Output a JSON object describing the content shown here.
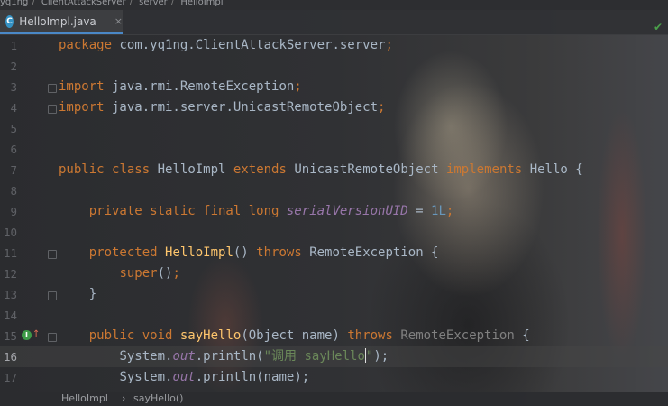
{
  "breadcrumb_top": [
    "yq1ng",
    "ClientAttackServer",
    "server",
    "HelloImpl"
  ],
  "tab": {
    "icon_letter": "C",
    "label": "HelloImpl.java",
    "close": "×"
  },
  "status_breadcrumb": [
    "HelloImpl",
    "sayHello()"
  ],
  "line_numbers": [
    "1",
    "2",
    "3",
    "4",
    "5",
    "6",
    "7",
    "8",
    "9",
    "10",
    "11",
    "12",
    "13",
    "14",
    "15",
    "16",
    "17"
  ],
  "code": {
    "l1_kw": "package",
    "l1_pkg": " com.yq1ng.ClientAttackServer.server",
    "l3_kw": "import",
    "l3_path": " java.rmi.RemoteException",
    "l4_kw": "import",
    "l4_path": " java.rmi.server.UnicastRemoteObject",
    "l6_public": "public",
    "l6_class": "class",
    "l6_name": "HelloImpl",
    "l6_extends": "extends",
    "l6_super": "UnicastRemoteObject",
    "l6_implements": "implements",
    "l6_iface": "Hello",
    "l8_mods": "private static final long",
    "l8_field": "serialVersionUID",
    "l8_val": "1L",
    "l10_mod": "protected",
    "l10_name": "HelloImpl",
    "l10_throws": "throws",
    "l10_exc": "RemoteException",
    "l11_super": "super",
    "l14_mods": "public void",
    "l14_name": "sayHello",
    "l14_params": "(Object name) ",
    "l14_throws": "throws",
    "l14_exc": "RemoteException",
    "l15_pre": "System.",
    "l15_out": "out",
    "l15_mid": ".println(",
    "l15_str": "\"调用 sayHello",
    "l15_str_end": "\"",
    "l15_tail": ");",
    "l16_pre": "System.",
    "l16_out": "out",
    "l16_tail": ".println(name);"
  }
}
